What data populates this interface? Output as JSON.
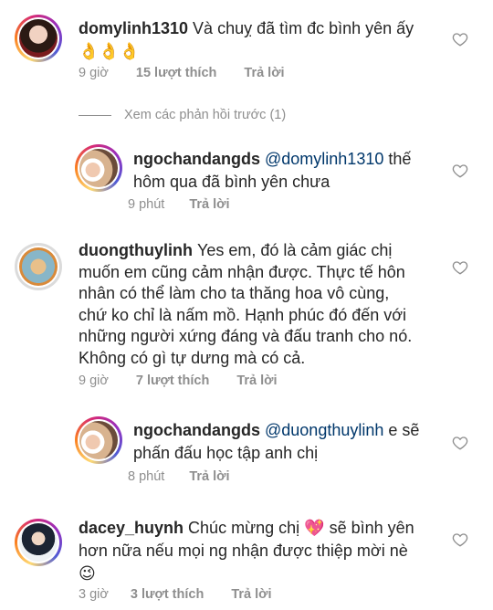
{
  "comments": [
    {
      "username": "domylinh1310",
      "text": "Và chuỵ đã tìm đc bình yên ấy",
      "emoji": "👌👌👌",
      "time": "9 giờ",
      "likes": "15 lượt thích",
      "reply": "Trả lời"
    },
    {
      "username": "ngochandangds",
      "mention": "@domylinh1310",
      "text_line1": " thế",
      "text_line2": "hôm qua đã bình yên chưa",
      "time": "9 phút",
      "reply": "Trả lời"
    },
    {
      "username": "duongthuylinh",
      "text_line1": "Yes em, đó là cảm giác chị",
      "text_line2": "muốn em cũng cảm nhận được. Thực tế hôn",
      "text_line3": "nhân có thể làm cho ta thăng hoa vô cùng,",
      "text_line4": "chứ ko chỉ là nấm mồ. Hạnh phúc đó đến với",
      "text_line5": "những người xứng đáng và đấu tranh cho nó.",
      "text_line6": "Không có gì tự dưng mà có cả.",
      "time": "9 giờ",
      "likes": "7 lượt thích",
      "reply": "Trả lời"
    },
    {
      "username": "ngochandangds",
      "mention": "@duongthuylinh",
      "text_line1": " e sẽ",
      "text_line2": "phấn đấu học tập anh chị",
      "time": "8 phút",
      "reply": "Trả lời"
    },
    {
      "username": "dacey_huynh",
      "text_line1a": "Chúc mừng chị ",
      "heart_emoji": "💖",
      "text_line1b": " sẽ bình yên",
      "text_line2": "hơn nữa nếu mọi ng nhận được thiệp mời nè",
      "emoji_line3": "😉",
      "time": "3 giờ",
      "likes": "3 lượt thích",
      "reply": "Trả lời"
    }
  ],
  "view_replies": "Xem các phản hồi trước (1)",
  "colors": {
    "text": "#262626",
    "meta": "#8e8e8e",
    "mention": "#00376b"
  },
  "icons": {
    "like": "heart-outline-icon"
  }
}
